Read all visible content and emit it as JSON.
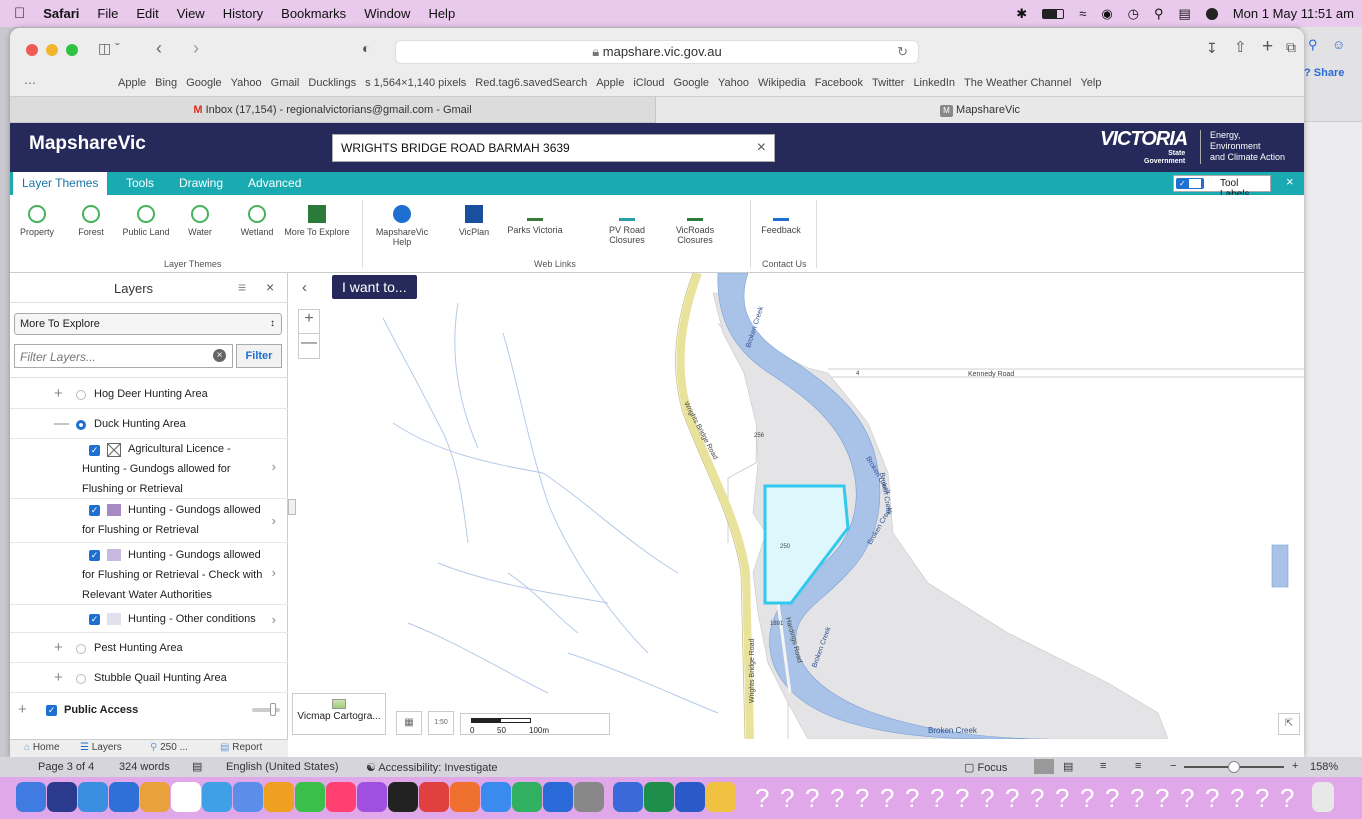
{
  "menubar": {
    "apple": "",
    "items": [
      "Safari",
      "File",
      "Edit",
      "View",
      "History",
      "Bookmarks",
      "Window",
      "Help"
    ],
    "clock": "Mon 1 May  11:51 am"
  },
  "browser": {
    "url": "mapshare.vic.gov.au",
    "favorites": [
      "Apple",
      "Bing",
      "Google",
      "Yahoo",
      "Gmail",
      "Ducklings",
      "s 1,564×1,140 pixels",
      "Red.tag6.savedSearch",
      "Apple",
      "iCloud",
      "Google",
      "Yahoo",
      "Wikipedia",
      "Facebook",
      "Twitter",
      "LinkedIn",
      "The Weather Channel",
      "Yelp"
    ],
    "tabs": [
      {
        "label": "Inbox (17,154) - regionalvictorians@gmail.com - Gmail"
      },
      {
        "label": "MapshareVic"
      }
    ],
    "share_label": "Share"
  },
  "app": {
    "name": "MapshareVic",
    "search_value": "WRIGHTS BRIDGE ROAD BARMAH 3639",
    "brand_main": "VICTORIA",
    "brand_sub1": "State",
    "brand_sub2": "Government",
    "dept1": "Energy,",
    "dept2": "Environment",
    "dept3": "and Climate Action",
    "ribbon_tabs": [
      "Layer Themes",
      "Tools",
      "Drawing",
      "Advanced"
    ],
    "tool_labels": "Tool Labels",
    "ribbon_items": [
      {
        "label": "Property"
      },
      {
        "label": "Forest"
      },
      {
        "label": "Public Land"
      },
      {
        "label": "Water"
      },
      {
        "label": "Wetland"
      },
      {
        "label": "More To Explore"
      },
      {
        "label": "MapshareVic Help"
      },
      {
        "label": "VicPlan"
      },
      {
        "label": "Parks Victoria"
      },
      {
        "label": "PV Road Closures"
      },
      {
        "label": "VicRoads Closures"
      },
      {
        "label": "Feedback"
      }
    ],
    "ribbon_groups": [
      "Layer Themes",
      "Web Links",
      "Contact Us"
    ]
  },
  "panel": {
    "title": "Layers",
    "theme_select": "More To Explore",
    "filter_placeholder": "Filter Layers...",
    "filter_button": "Filter",
    "layers": [
      {
        "label": "Hog Deer Hunting Area"
      },
      {
        "label": "Duck Hunting Area"
      },
      {
        "l1": "Agricultural Licence -",
        "l2": "Hunting - Gundogs allowed for",
        "l3": "Flushing or Retrieval"
      },
      {
        "l1": "Hunting - Gundogs allowed",
        "l2": "for Flushing or Retrieval"
      },
      {
        "l1": "Hunting - Gundogs allowed",
        "l2": "for Flushing or Retrieval - Check with",
        "l3": "Relevant Water Authorities"
      },
      {
        "label": "Hunting - Other conditions"
      },
      {
        "label": "Pest Hunting Area"
      },
      {
        "label": "Stubble Quail Hunting Area"
      },
      {
        "label": "Public Access"
      }
    ],
    "bottom_tabs": [
      "Home",
      "Layers",
      "250 ...",
      "Report"
    ]
  },
  "map": {
    "i_want_to": "I want to...",
    "labels": {
      "broken_creek_1": "Broken Creek",
      "broken_creek_2": "Broken Creek",
      "broken_creek_3": "Broken Creek",
      "broken_creek_4": "Broken Creek",
      "broken_creek_5": "Broken Creek",
      "kennedy_road": "Kennedy Road",
      "wrights_bridge_road_1": "Wrights Bridge Road",
      "wrights_bridge_road_2": "Wrights Bridge Road",
      "hardings_road": "Hardings Road",
      "num_256": "256",
      "num_250": "250",
      "num_1891": "1891",
      "num_4": "4"
    },
    "basemap_label": "Vicmap Cartogra...",
    "scale_0": "0",
    "scale_50": "50",
    "scale_100": "100m",
    "selected_color": "#33c9ec",
    "water_color": "#a9c3e8"
  },
  "word_status": {
    "page": "Page 3 of 4",
    "words": "324 words",
    "language": "English (United States)",
    "accessibility": "Accessibility: Investigate",
    "focus": "Focus",
    "zoom": "158%"
  }
}
